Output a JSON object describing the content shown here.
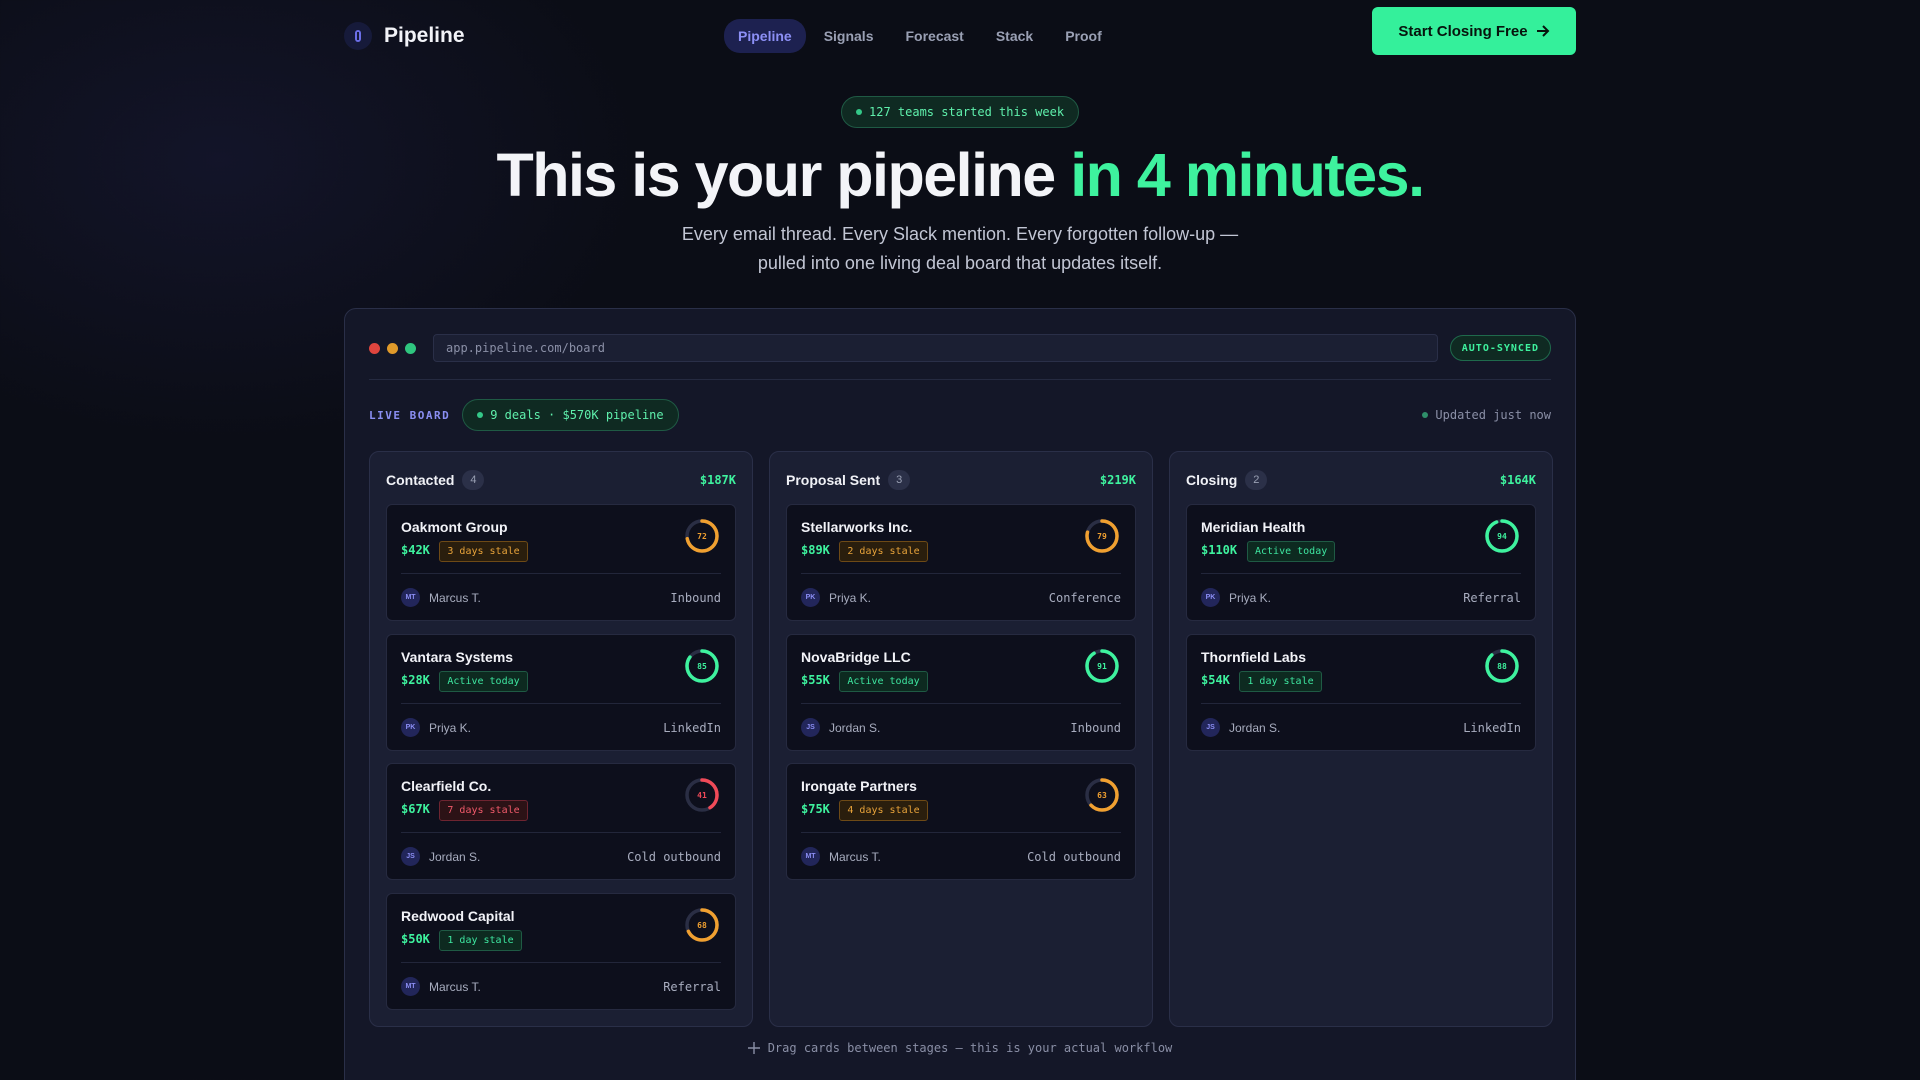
{
  "nav": {
    "brand": "Pipeline",
    "links": [
      {
        "label": "Pipeline",
        "active": true
      },
      {
        "label": "Signals"
      },
      {
        "label": "Forecast"
      },
      {
        "label": "Stack"
      },
      {
        "label": "Proof"
      }
    ],
    "cta": "Start Closing Free"
  },
  "hero": {
    "badge": "127 teams started this week",
    "title_main": "This is your pipeline ",
    "title_accent": "in 4 minutes.",
    "subtitle_line1": "Every email thread. Every Slack mention. Every forgotten follow-up —",
    "subtitle_line2": "pulled into one living deal board that updates itself."
  },
  "board": {
    "url": "app.pipeline.com/board",
    "synced": "AUTO-SYNCED",
    "live_label": "LIVE BOARD",
    "deals_summary": "9 deals · $570K pipeline",
    "updated": "Updated just now",
    "hint": "Drag cards between stages — this is your actual workflow",
    "colors": {
      "amber": "#f0a030",
      "green": "#3ef29e",
      "red": "#f04a58",
      "track": "#2a2e44"
    },
    "columns": [
      {
        "title": "Contacted",
        "count": "4",
        "total": "$187K",
        "cards": [
          {
            "name": "Oakmont Group",
            "value": "$42K",
            "tag": "3 days stale",
            "tag_color": "amber",
            "score": 72,
            "ring_color": "amber",
            "initials": "MT",
            "owner": "Marcus T.",
            "source": "Inbound"
          },
          {
            "name": "Vantara Systems",
            "value": "$28K",
            "tag": "Active today",
            "tag_color": "green",
            "score": 85,
            "ring_color": "green",
            "initials": "PK",
            "owner": "Priya K.",
            "source": "LinkedIn"
          },
          {
            "name": "Clearfield Co.",
            "value": "$67K",
            "tag": "7 days stale",
            "tag_color": "red",
            "score": 41,
            "ring_color": "red",
            "initials": "JS",
            "owner": "Jordan S.",
            "source": "Cold outbound"
          },
          {
            "name": "Redwood Capital",
            "value": "$50K",
            "tag": "1 day stale",
            "tag_color": "green",
            "score": 68,
            "ring_color": "amber",
            "initials": "MT",
            "owner": "Marcus T.",
            "source": "Referral"
          }
        ]
      },
      {
        "title": "Proposal Sent",
        "count": "3",
        "total": "$219K",
        "cards": [
          {
            "name": "Stellarworks Inc.",
            "value": "$89K",
            "tag": "2 days stale",
            "tag_color": "amber",
            "score": 79,
            "ring_color": "amber",
            "initials": "PK",
            "owner": "Priya K.",
            "source": "Conference"
          },
          {
            "name": "NovaBridge LLC",
            "value": "$55K",
            "tag": "Active today",
            "tag_color": "green",
            "score": 91,
            "ring_color": "green",
            "initials": "JS",
            "owner": "Jordan S.",
            "source": "Inbound"
          },
          {
            "name": "Irongate Partners",
            "value": "$75K",
            "tag": "4 days stale",
            "tag_color": "amber",
            "score": 63,
            "ring_color": "amber",
            "initials": "MT",
            "owner": "Marcus T.",
            "source": "Cold outbound"
          }
        ]
      },
      {
        "title": "Closing",
        "count": "2",
        "total": "$164K",
        "cards": [
          {
            "name": "Meridian Health",
            "value": "$110K",
            "tag": "Active today",
            "tag_color": "green",
            "score": 94,
            "ring_color": "green",
            "initials": "PK",
            "owner": "Priya K.",
            "source": "Referral"
          },
          {
            "name": "Thornfield Labs",
            "value": "$54K",
            "tag": "1 day stale",
            "tag_color": "green",
            "score": 88,
            "ring_color": "green",
            "initials": "JS",
            "owner": "Jordan S.",
            "source": "LinkedIn"
          }
        ]
      }
    ]
  }
}
